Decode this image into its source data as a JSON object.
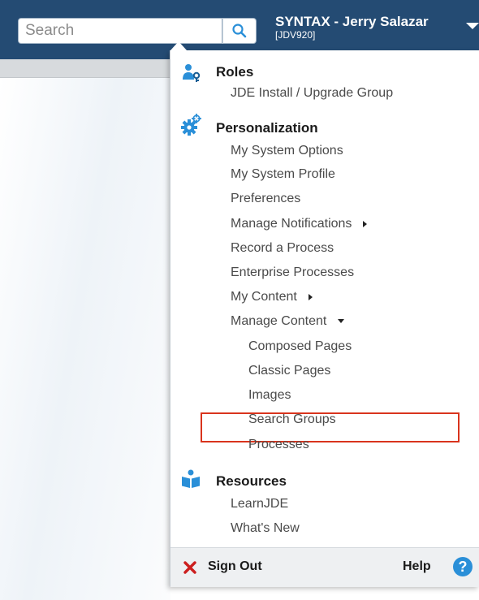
{
  "search": {
    "placeholder": "Search"
  },
  "user": {
    "name": "SYNTAX - Jerry Salazar",
    "environment": "[JDV920]"
  },
  "menu": {
    "roles": {
      "title": "Roles",
      "items": [
        "JDE Install / Upgrade Group"
      ]
    },
    "personalization": {
      "title": "Personalization",
      "items": [
        "My System Options",
        "My System Profile",
        "Preferences",
        "Manage Notifications",
        "Record a Process",
        "Enterprise Processes",
        "My Content",
        "Manage Content"
      ],
      "manage_content_subitems": [
        "Composed Pages",
        "Classic Pages",
        "Images",
        "Search Groups",
        "Processes"
      ]
    },
    "resources": {
      "title": "Resources",
      "items": [
        "LearnJDE",
        "What's New"
      ]
    },
    "footer": {
      "sign_out": "Sign Out",
      "help": "Help",
      "help_glyph": "?"
    }
  },
  "colors": {
    "topbar": "#244b73",
    "highlight": "#d9341d",
    "icon_blue": "#2a8fd8",
    "sign_out_red": "#cc1f1f"
  }
}
